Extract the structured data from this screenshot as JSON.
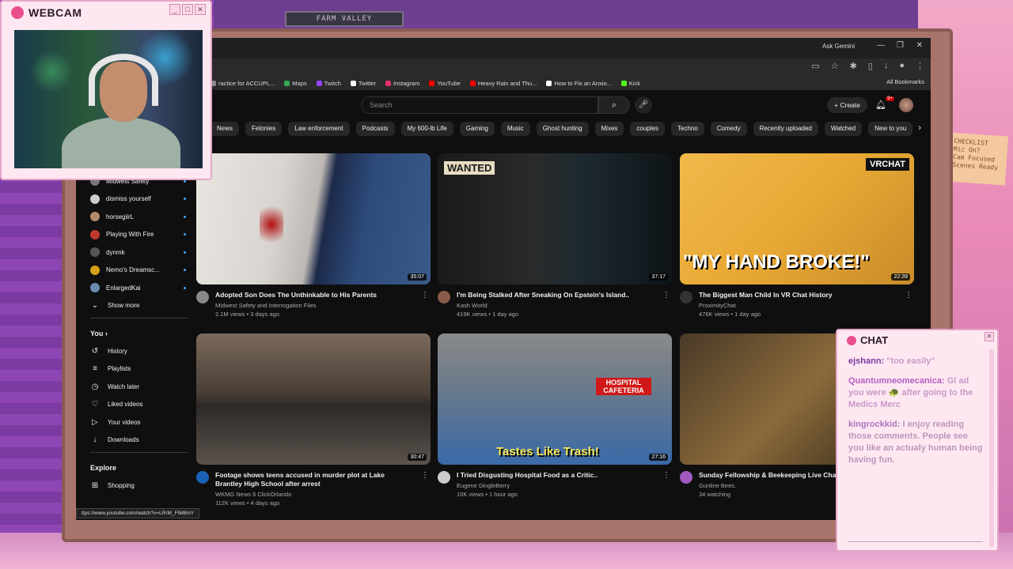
{
  "room": {
    "shelf_sign": "FARM VALLEY",
    "sticky_note": "CHECKLIST\nMic On?\nCam Focused\nScenes Ready"
  },
  "browser": {
    "ask_gemini": "Ask Gemini",
    "bookmarks": [
      {
        "label": "ractice for ACCUPL...",
        "color": "#8a8a8a"
      },
      {
        "label": "Maps",
        "color": "#34a853"
      },
      {
        "label": "Twitch",
        "color": "#9146ff"
      },
      {
        "label": "Twitter",
        "color": "#ffffff"
      },
      {
        "label": "Instagram",
        "color": "#e1306c"
      },
      {
        "label": "YouTube",
        "color": "#ff0000"
      },
      {
        "label": "Heavy Rain and Thu...",
        "color": "#ff0000"
      },
      {
        "label": "How to Fix an Anxio...",
        "color": "#ffffff"
      },
      {
        "label": "Kick",
        "color": "#53fc18"
      }
    ],
    "all_bookmarks": "All Bookmarks",
    "status_url": "ttps://www.youtube.com/watch?v=LRrM_FtM8mY"
  },
  "header": {
    "search_placeholder": "Search",
    "create_label": "Create",
    "notification_count": "9+"
  },
  "chips": [
    "News",
    "Felonies",
    "Law enforcement",
    "Podcasts",
    "My 600-lb Life",
    "Gaming",
    "Music",
    "Ghost hunting",
    "Mixes",
    "couples",
    "Techno",
    "Comedy",
    "Recently uploaded",
    "Watched",
    "New to you"
  ],
  "sidebar": {
    "subscriptions": [
      {
        "name": "Midwest Safety",
        "color": "#777777"
      },
      {
        "name": "dismiss yourself",
        "color": "#cccccc"
      },
      {
        "name": "horsegiirL",
        "color": "#b38b6d"
      },
      {
        "name": "Playing With Fire",
        "color": "#c0392b"
      },
      {
        "name": "dynmk",
        "color": "#555555"
      },
      {
        "name": "Nemo's Dreamsc...",
        "color": "#d4a017"
      },
      {
        "name": "EnlargedKai",
        "color": "#6a8caf"
      }
    ],
    "show_more": "Show more",
    "you_heading": "You",
    "you_items": [
      {
        "label": "History",
        "icon": "history-icon",
        "glyph": "↺"
      },
      {
        "label": "Playlists",
        "icon": "playlist-icon",
        "glyph": "≡"
      },
      {
        "label": "Watch later",
        "icon": "clock-icon",
        "glyph": "◷"
      },
      {
        "label": "Liked videos",
        "icon": "thumbs-up-icon",
        "glyph": "♡"
      },
      {
        "label": "Your videos",
        "icon": "video-icon",
        "glyph": "▷"
      },
      {
        "label": "Downloads",
        "icon": "download-icon",
        "glyph": "↓"
      }
    ],
    "explore_heading": "Explore",
    "explore_items": [
      {
        "label": "Shopping",
        "icon": "shopping-bag-icon",
        "glyph": "⊞"
      }
    ]
  },
  "videos": [
    {
      "title": "Adopted Son Does The Unthinkable to His Parents",
      "channel": "Midwest Safety and Interrogation Files",
      "stats": "2.1M views • 3 days ago",
      "duration": "35:07",
      "avatar": "#888888"
    },
    {
      "title": "I'm Being Stalked After Sneaking On Epstein's Island..",
      "channel": "Kash World",
      "stats": "419K views • 1 day ago",
      "duration": "37:17",
      "avatar": "#8a5a4a",
      "overlay": "WANTED"
    },
    {
      "title": "The Biggest Man Child In VR Chat History",
      "channel": "ProximityChat",
      "stats": "476K views • 1 day ago",
      "duration": "22:39",
      "avatar": "#333333",
      "overlay": "\"MY HAND BROKE!\"",
      "badge": "VRCHAT"
    },
    {
      "title": "Footage shows teens accused in murder plot at Lake Brantley High School after arrest",
      "channel": "WKMG News 6 ClickOrlando",
      "stats": "112K views • 4 days ago",
      "duration": "30:47",
      "avatar": "#1a5fb4"
    },
    {
      "title": "I Tried Disgusting Hospital Food as a Critic..",
      "channel": "Eugene DingleBerry",
      "stats": "16K views • 1 hour ago",
      "duration": "27:16",
      "avatar": "#cccccc",
      "overlay": "Tastes Like Trash!",
      "badge": "HOSPITAL CAFETERIA"
    },
    {
      "title": "Sunday Fellowship & Beekeeping Live Chat",
      "channel": "Gunline Bees.",
      "stats": "34 watching",
      "duration": "",
      "avatar": "#a05ac0"
    }
  ],
  "webcam": {
    "title": "WEBCAM"
  },
  "chat": {
    "title": "CHAT",
    "messages": [
      {
        "user": "ejshann:",
        "text": "\"too easily\""
      },
      {
        "user": "Quantumneomecanica:",
        "text": "Gl ad you were 🐢 after going to the Medics Merc"
      },
      {
        "user": "kingrockkid:",
        "text": "I enjoy reading those comments. People see you like an actualy human being having fun."
      }
    ]
  }
}
